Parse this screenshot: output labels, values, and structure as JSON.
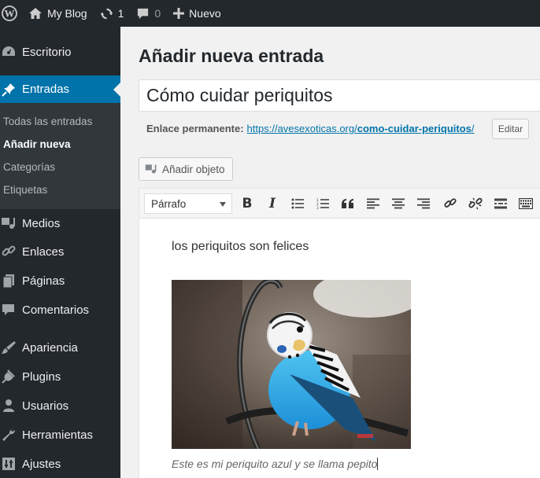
{
  "admin_bar": {
    "site_name": "My Blog",
    "updates_count": "1",
    "comments_count": "0",
    "new_label": "Nuevo"
  },
  "sidebar": {
    "items": [
      {
        "label": "Escritorio",
        "icon": "dashboard-icon"
      },
      {
        "label": "Entradas",
        "icon": "pin-icon",
        "active": true
      },
      {
        "label": "Medios",
        "icon": "media-icon"
      },
      {
        "label": "Enlaces",
        "icon": "link-icon"
      },
      {
        "label": "Páginas",
        "icon": "pages-icon"
      },
      {
        "label": "Comentarios",
        "icon": "comment-icon"
      },
      {
        "label": "Apariencia",
        "icon": "brush-icon"
      },
      {
        "label": "Plugins",
        "icon": "plug-icon"
      },
      {
        "label": "Usuarios",
        "icon": "user-icon"
      },
      {
        "label": "Herramientas",
        "icon": "wrench-icon"
      },
      {
        "label": "Ajustes",
        "icon": "settings-icon"
      }
    ],
    "submenu": [
      {
        "label": "Todas las entradas"
      },
      {
        "label": "Añadir nueva",
        "current": true
      },
      {
        "label": "Categorías"
      },
      {
        "label": "Etiquetas"
      }
    ]
  },
  "main": {
    "page_title": "Añadir nueva entrada",
    "post_title": "Cómo cuidar periquitos",
    "permalink_label": "Enlace permanente:",
    "permalink_base": "https://avesexoticas.org/",
    "permalink_slug": "como-cuidar-periquitos",
    "permalink_trailing": "/",
    "edit_label": "Editar",
    "add_media_label": "Añadir objeto"
  },
  "editor": {
    "format_value": "Párrafo",
    "paragraph": "los periquitos son felices",
    "caption": "Este es mi periquito azul y se llama pepito"
  },
  "colors": {
    "admin_dark": "#23282d",
    "accent_blue": "#0073aa",
    "background": "#f1f1f1"
  }
}
